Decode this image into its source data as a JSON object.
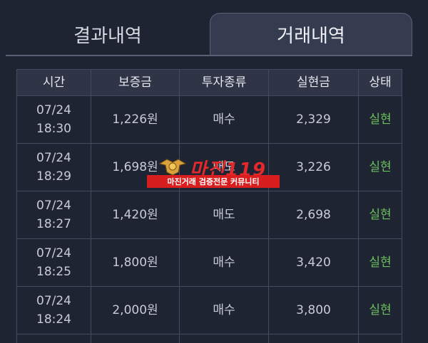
{
  "tabs": [
    {
      "label": "결과내역",
      "active": false
    },
    {
      "label": "거래내역",
      "active": true
    }
  ],
  "table": {
    "headers": [
      "시간",
      "보증금",
      "투자종류",
      "실현금",
      "상태"
    ],
    "rows": [
      {
        "date": "07/24",
        "time": "18:30",
        "deposit": "1,226원",
        "type": "매수",
        "realized": "2,329",
        "status": "실현"
      },
      {
        "date": "07/24",
        "time": "18:29",
        "deposit": "1,698원",
        "type": "매도",
        "realized": "3,226",
        "status": "실현"
      },
      {
        "date": "07/24",
        "time": "18:27",
        "deposit": "1,420원",
        "type": "매도",
        "realized": "2,698",
        "status": "실현"
      },
      {
        "date": "07/24",
        "time": "18:25",
        "deposit": "1,800원",
        "type": "매수",
        "realized": "3,420",
        "status": "실현"
      },
      {
        "date": "07/24",
        "time": "18:24",
        "deposit": "2,000원",
        "type": "매수",
        "realized": "3,800",
        "status": "실현"
      }
    ]
  },
  "watermark": {
    "title": "마진119",
    "subtitle": "마진거래 검증전문 커뮤니티"
  },
  "colors": {
    "background": "#1f2433",
    "active_tab": "#363c50",
    "status_green": "#6bbf5c",
    "watermark_red": "#d81e1e"
  }
}
